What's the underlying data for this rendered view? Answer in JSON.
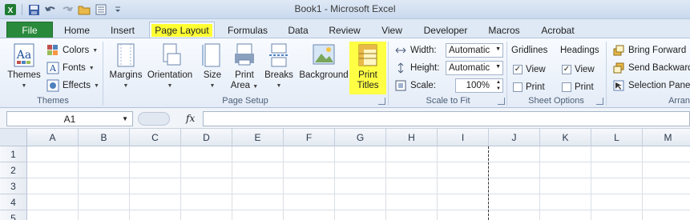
{
  "window": {
    "title": "Book1  -  Microsoft Excel"
  },
  "qat": {
    "icons": [
      "excel-logo-icon",
      "save-icon",
      "undo-icon",
      "redo-icon",
      "open-folder-icon",
      "form-icon",
      "customize-qat-icon"
    ]
  },
  "tabs": {
    "file": "File",
    "items": [
      "Home",
      "Insert",
      "Page Layout",
      "Formulas",
      "Data",
      "Review",
      "View",
      "Developer",
      "Macros",
      "Acrobat"
    ],
    "active": "Page Layout"
  },
  "ribbon": {
    "themes_group": {
      "label": "Themes",
      "themes_btn": "Themes",
      "colors": "Colors",
      "fonts": "Fonts",
      "effects": "Effects"
    },
    "page_setup_group": {
      "label": "Page Setup",
      "margins": "Margins",
      "orientation": "Orientation",
      "size": "Size",
      "print_area_1": "Print",
      "print_area_2": "Area",
      "breaks": "Breaks",
      "background": "Background",
      "print_titles_1": "Print",
      "print_titles_2": "Titles"
    },
    "scale_group": {
      "label": "Scale to Fit",
      "width_label": "Width:",
      "width_value": "Automatic",
      "height_label": "Height:",
      "height_value": "Automatic",
      "scale_label": "Scale:",
      "scale_value": "100%"
    },
    "sheet_options_group": {
      "label": "Sheet Options",
      "gridlines": "Gridlines",
      "headings": "Headings",
      "view": "View",
      "print": "Print",
      "gridlines_view_checked": true,
      "gridlines_print_checked": false,
      "headings_view_checked": true,
      "headings_print_checked": false
    },
    "arrange_group": {
      "label": "Arran",
      "bring_forward": "Bring Forward",
      "send_backward": "Send Backward",
      "selection_pane": "Selection Pane"
    }
  },
  "formula_bar": {
    "name_box": "A1",
    "fx": "fx",
    "value": ""
  },
  "grid": {
    "columns": [
      "A",
      "B",
      "C",
      "D",
      "E",
      "F",
      "G",
      "H",
      "I",
      "J",
      "K",
      "L",
      "M"
    ],
    "rows": [
      "1",
      "2",
      "3",
      "4",
      "5"
    ]
  },
  "colors": {
    "file_tab": "#2a8a3c",
    "highlight": "#ffff33"
  }
}
